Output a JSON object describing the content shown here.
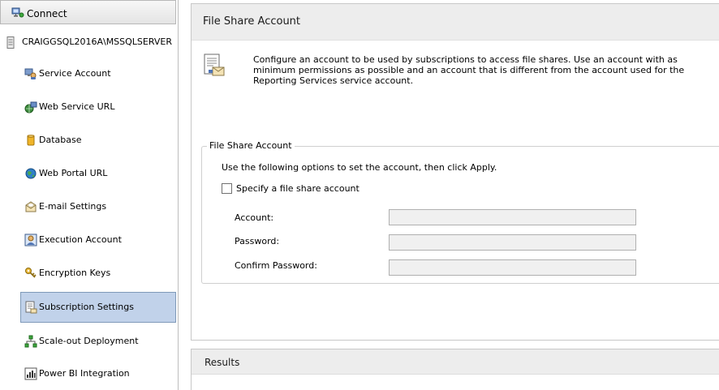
{
  "sidebar": {
    "connect_label": "Connect",
    "server_label": "CRAIGGSQL2016A\\MSSQLSERVER",
    "items": [
      {
        "label": "Service Account",
        "icon": "service-account-icon"
      },
      {
        "label": "Web Service URL",
        "icon": "web-service-url-icon"
      },
      {
        "label": "Database",
        "icon": "database-icon"
      },
      {
        "label": "Web Portal URL",
        "icon": "globe-icon"
      },
      {
        "label": "E-mail Settings",
        "icon": "email-icon"
      },
      {
        "label": "Execution Account",
        "icon": "execution-account-icon"
      },
      {
        "label": "Encryption Keys",
        "icon": "keys-icon"
      },
      {
        "label": "Subscription Settings",
        "icon": "subscription-icon",
        "selected": true
      },
      {
        "label": "Scale-out Deployment",
        "icon": "scale-out-icon"
      },
      {
        "label": "Power BI Integration",
        "icon": "power-bi-icon"
      }
    ]
  },
  "main": {
    "title": "File Share Account",
    "description": "Configure an account to be used by subscriptions to access file shares. Use an account with as minimum permissions as possible and an account that is different from the account used for the Reporting Services service account.",
    "group": {
      "legend": "File Share Account",
      "instructions": "Use the following options to set the account, then click Apply.",
      "checkbox_label": "Specify a file share account",
      "checkbox_checked": false,
      "account_label": "Account:",
      "account_value": "",
      "password_label": "Password:",
      "password_value": "",
      "confirm_password_label": "Confirm Password:",
      "confirm_password_value": ""
    }
  },
  "results": {
    "title": "Results"
  },
  "colors": {
    "selected_bg": "#c1d2ea",
    "selected_border": "#7f9ab9",
    "header_bg": "#ededed",
    "disabled_field_bg": "#f0f0f0"
  }
}
